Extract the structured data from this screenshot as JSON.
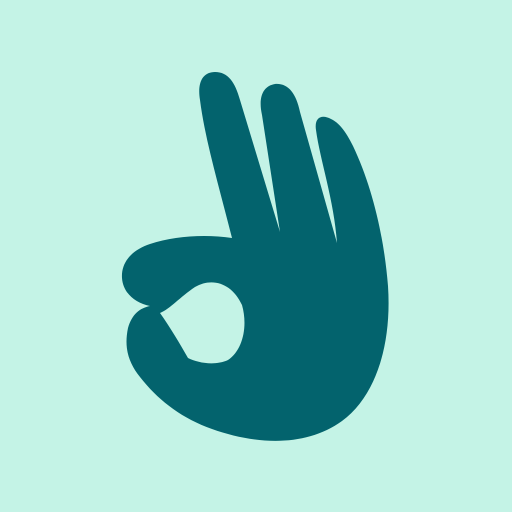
{
  "icon": {
    "name": "ok-hand-icon",
    "background_color": "#c4f3e6",
    "fill_color": "#03636d"
  }
}
